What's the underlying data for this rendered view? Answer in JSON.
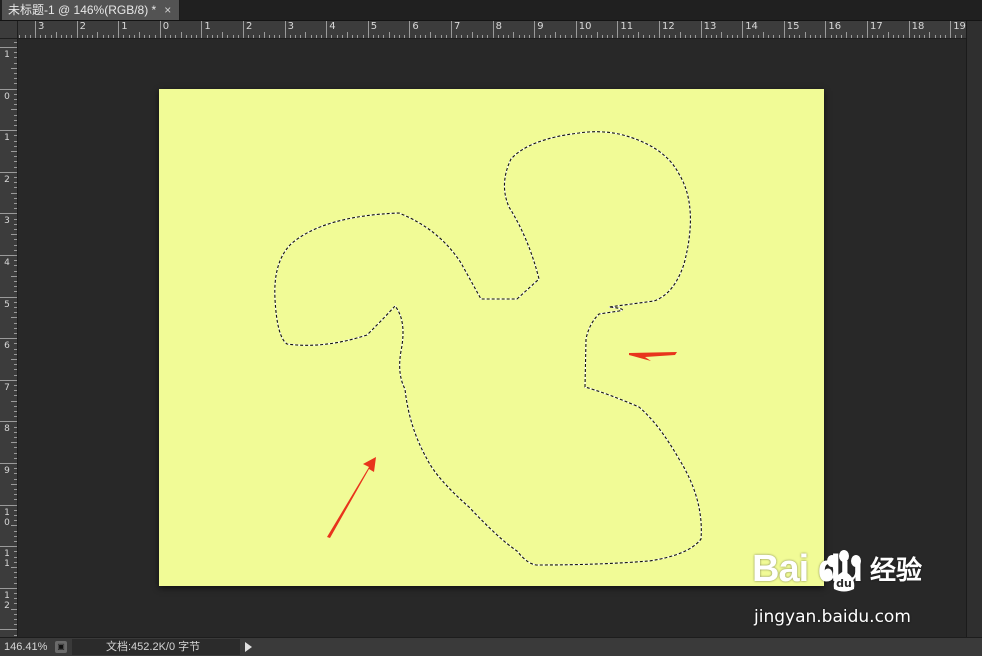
{
  "document_tab": {
    "title": "未标题-1 @ 146%(RGB/8) *",
    "close_glyph": "×"
  },
  "rulers": {
    "horizontal_labels": [
      "3",
      "2",
      "1",
      "0",
      "1",
      "2",
      "3",
      "4",
      "5",
      "6",
      "7",
      "8",
      "9",
      "10",
      "11",
      "12",
      "13",
      "14",
      "15",
      "16",
      "17",
      "18",
      "19"
    ],
    "vertical_labels": [
      "1",
      "0",
      "1",
      "2",
      "3",
      "4",
      "5",
      "6",
      "7",
      "8",
      "9",
      "10",
      "11",
      "12"
    ]
  },
  "canvas": {
    "background_color": "#f1fb96",
    "selection_marquee": "marching-ants",
    "arrows_color": "#e8341c"
  },
  "status_bar": {
    "zoom": "146.41%",
    "doc_info": "文档:452.2K/0 字节",
    "info_icon": "document-info-icon",
    "menu_arrow_icon": "triangle-right-icon"
  },
  "watermark": {
    "logo_text": "Bai  du",
    "logo_cn": "经验",
    "url": "jingyan.baidu.com"
  }
}
